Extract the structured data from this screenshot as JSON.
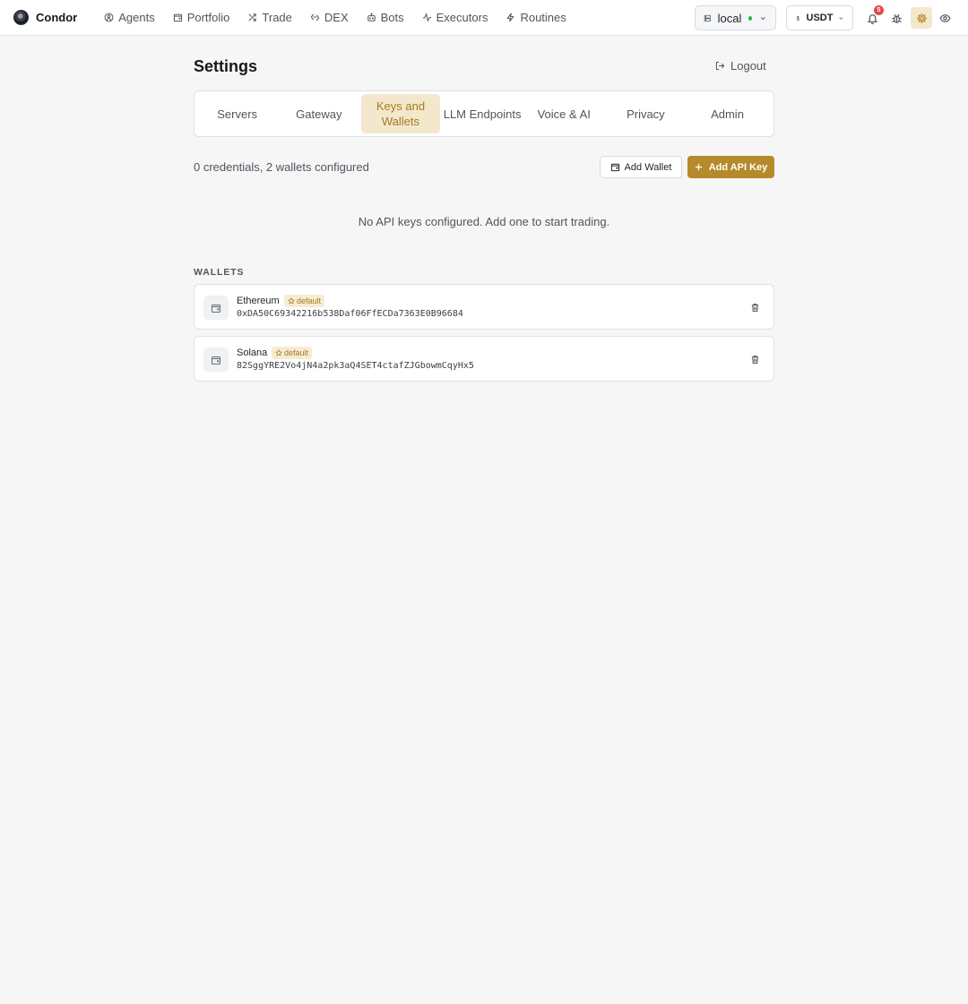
{
  "app": {
    "name": "Condor"
  },
  "nav": {
    "items": [
      {
        "label": "Agents",
        "icon": "agents-icon"
      },
      {
        "label": "Portfolio",
        "icon": "wallet-icon"
      },
      {
        "label": "Trade",
        "icon": "trade-icon"
      },
      {
        "label": "DEX",
        "icon": "dex-icon"
      },
      {
        "label": "Bots",
        "icon": "bot-icon"
      },
      {
        "label": "Executors",
        "icon": "activity-icon"
      },
      {
        "label": "Routines",
        "icon": "bolt-icon"
      }
    ],
    "server": {
      "label": "local",
      "status_color": "#2fb344"
    },
    "currency": {
      "label": "USDT"
    },
    "notifications": {
      "count": "5"
    }
  },
  "page": {
    "title": "Settings",
    "logout_label": "Logout"
  },
  "tabs": [
    {
      "label": "Servers",
      "active": false
    },
    {
      "label": "Gateway",
      "active": false
    },
    {
      "label": "Keys and Wallets",
      "active": true
    },
    {
      "label": "LLM Endpoints",
      "active": false
    },
    {
      "label": "Voice & AI",
      "active": false
    },
    {
      "label": "Privacy",
      "active": false
    },
    {
      "label": "Admin",
      "active": false
    }
  ],
  "keys": {
    "summary": "0 credentials, 2 wallets configured",
    "add_wallet_label": "Add Wallet",
    "add_api_key_label": "Add API Key",
    "empty_message": "No API keys configured. Add one to start trading."
  },
  "wallets": {
    "section_label": "WALLETS",
    "items": [
      {
        "chain": "Ethereum",
        "badge": "default",
        "address": "0xDA50C69342216b538Daf06FfECDa7363E0B96684"
      },
      {
        "chain": "Solana",
        "badge": "default",
        "address": "82SggYRE2Vo4jN4a2pk3aQ4SET4ctafZJGbowmCqyHx5"
      }
    ]
  },
  "colors": {
    "accent": "#b58a2a",
    "accent_soft": "#f3e8cc",
    "danger": "#e5484d"
  }
}
